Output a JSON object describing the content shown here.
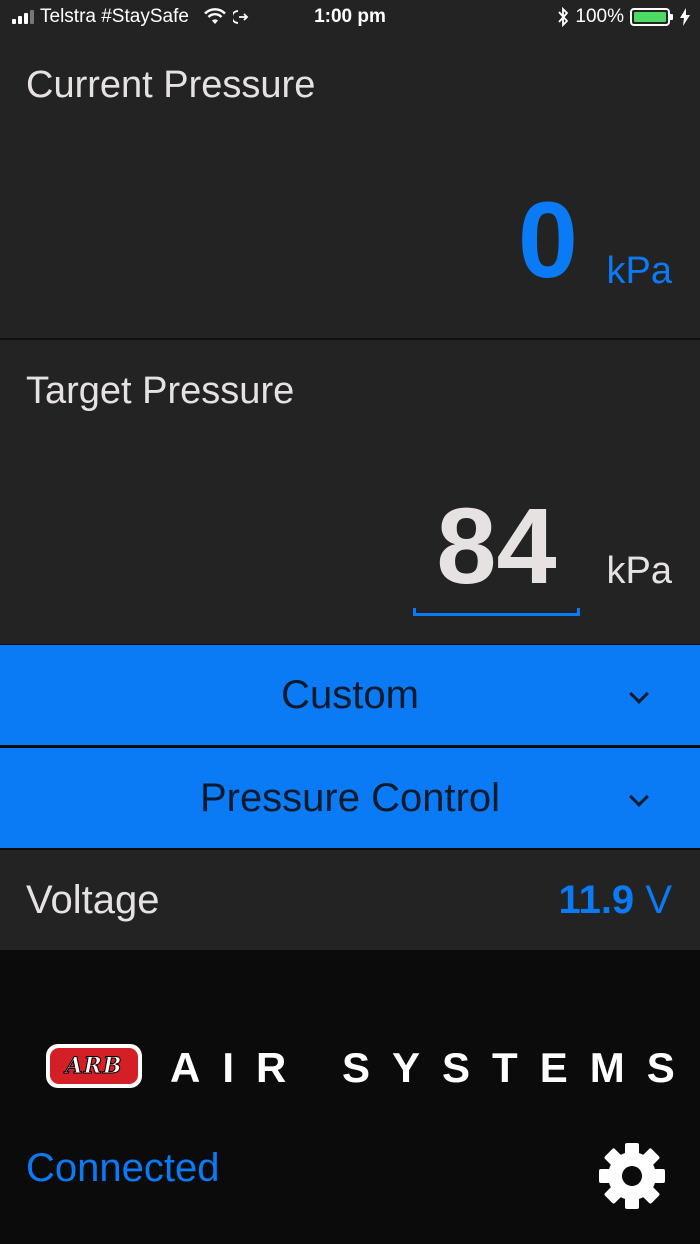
{
  "status_bar": {
    "carrier": "Telstra #StaySafe",
    "time": "1:00 pm",
    "battery": "100%",
    "icons": [
      "signal-icon",
      "wifi-icon",
      "location-arrow-icon",
      "bluetooth-icon",
      "battery-icon",
      "charging-icon"
    ]
  },
  "current_pressure": {
    "title": "Current Pressure",
    "value": "0",
    "unit": "kPa"
  },
  "target_pressure": {
    "title": "Target Pressure",
    "value": "84",
    "unit": "kPa"
  },
  "preset_select": {
    "label": "Custom"
  },
  "mode_select": {
    "label": "Pressure Control"
  },
  "voltage": {
    "label": "Voltage",
    "value": "11.9",
    "unit": "V"
  },
  "footer": {
    "logo_text": "ARB",
    "brand": "AIR SYSTEMS",
    "connection_status": "Connected"
  },
  "colors": {
    "accent": "#0a7af5",
    "panel": "#232323",
    "background": "#0b0b0b",
    "text": "#e6e2e2",
    "logo_red": "#d41f26"
  }
}
